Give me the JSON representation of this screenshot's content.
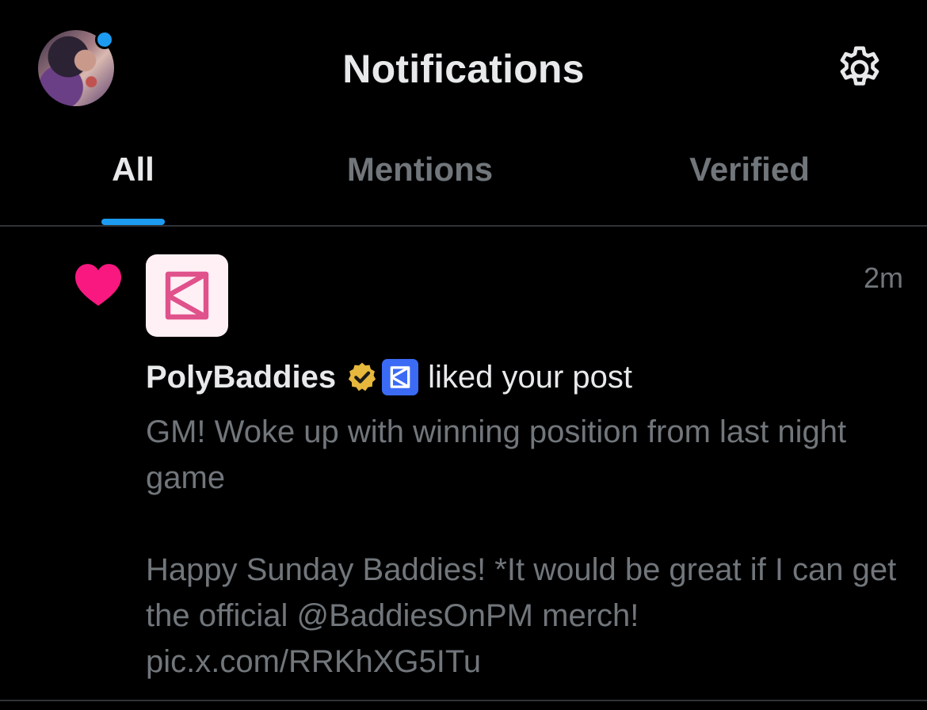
{
  "header": {
    "title": "Notifications",
    "avatar_icon": "profile-avatar",
    "settings_icon": "gear-icon",
    "indicator_color": "#1d9bf0"
  },
  "tabs": [
    {
      "label": "All",
      "active": true
    },
    {
      "label": "Mentions",
      "active": false
    },
    {
      "label": "Verified",
      "active": false
    }
  ],
  "notification": {
    "type_icon": "heart-icon",
    "type_color": "#f91880",
    "account_name": "PolyBaddies",
    "verified_badge": "gold-verified-badge-icon",
    "affiliate_badge": "polymarket-affiliate-icon",
    "action": "liked your post",
    "time": "2m",
    "post_text": "GM! Woke up with winning position from last night game\n\nHappy Sunday Baddies! *It would be great if I can get the official @BaddiesOnPM merch! pic.x.com/RRKhXG5ITu"
  },
  "colors": {
    "background": "#000000",
    "primary_text": "#e7e9ea",
    "secondary_text": "#71767b",
    "accent": "#1d9bf0",
    "divider": "#2f3336"
  }
}
